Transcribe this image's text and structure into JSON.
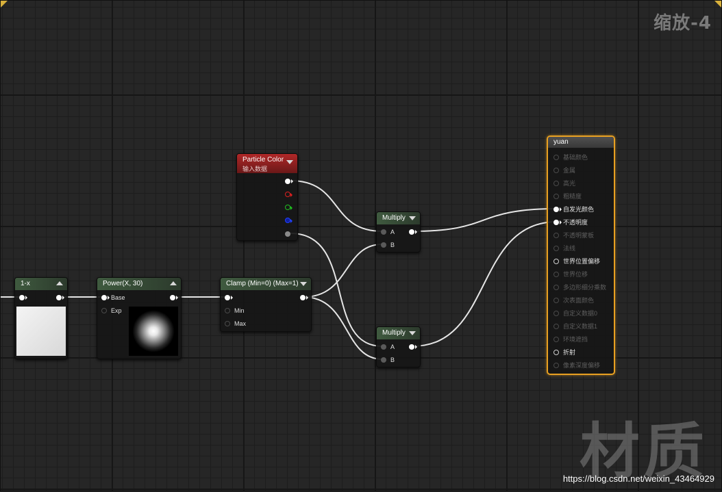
{
  "editor": {
    "zoom_label": "缩放-4",
    "watermark": "材质",
    "url": "https://blog.csdn.net/weixin_43464929"
  },
  "colors": {
    "accent_output": "#e8a021",
    "particle_header": "#b02828",
    "math_header": "#3f5a3f",
    "wire": "#e6e6e6"
  },
  "nodes": {
    "one_minus": {
      "title": "1-x"
    },
    "power": {
      "title": "Power(X, 30)",
      "pin_base": "Base",
      "pin_exp": "Exp"
    },
    "clamp": {
      "title": "Clamp (Min=0) (Max=1)",
      "pin_min": "Min",
      "pin_max": "Max"
    },
    "particle_color": {
      "title": "Particle Color",
      "subtitle": "输入数据"
    },
    "multiply_top": {
      "title": "Multiply",
      "pin_a": "A",
      "pin_b": "B"
    },
    "multiply_bottom": {
      "title": "Multiply",
      "pin_a": "A",
      "pin_b": "B"
    },
    "material_output": {
      "title": "yuan",
      "pins": [
        {
          "label": "基础颜色",
          "active": false
        },
        {
          "label": "金属",
          "active": false
        },
        {
          "label": "高光",
          "active": false
        },
        {
          "label": "粗糙度",
          "active": false
        },
        {
          "label": "自发光颜色",
          "active": true,
          "connected": true
        },
        {
          "label": "不透明度",
          "active": true,
          "connected": true
        },
        {
          "label": "不透明蒙板",
          "active": false
        },
        {
          "label": "法线",
          "active": false
        },
        {
          "label": "世界位置偏移",
          "active": true,
          "connected": false
        },
        {
          "label": "世界位移",
          "active": false
        },
        {
          "label": "多边形细分乘数",
          "active": false
        },
        {
          "label": "次表面颜色",
          "active": false
        },
        {
          "label": "自定义数据0",
          "active": false
        },
        {
          "label": "自定义数据1",
          "active": false
        },
        {
          "label": "环境遮挡",
          "active": false
        },
        {
          "label": "折射",
          "active": true,
          "connected": false
        },
        {
          "label": "像素深度偏移",
          "active": false
        }
      ]
    }
  }
}
